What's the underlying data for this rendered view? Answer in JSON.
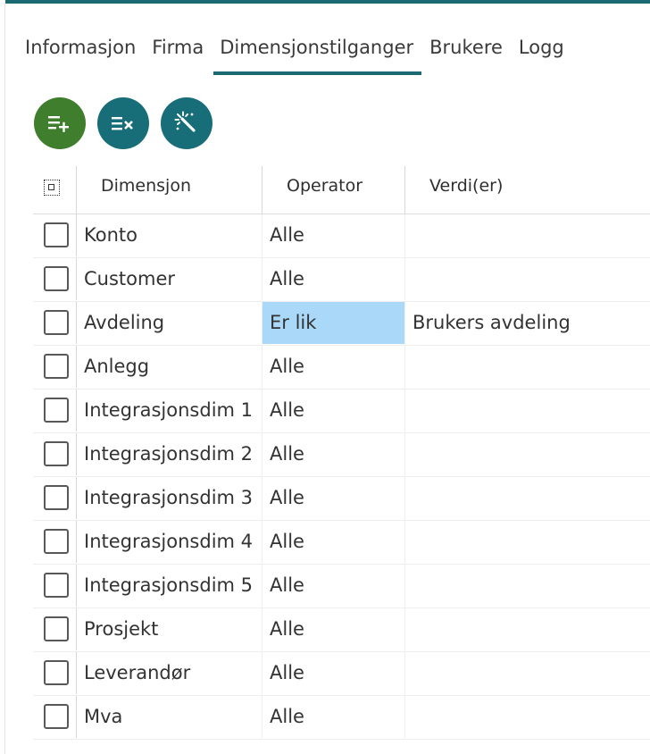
{
  "tabs": [
    {
      "label": "Informasjon",
      "active": false
    },
    {
      "label": "Firma",
      "active": false
    },
    {
      "label": "Dimensjonstilganger",
      "active": true
    },
    {
      "label": "Brukere",
      "active": false
    },
    {
      "label": "Logg",
      "active": false
    }
  ],
  "toolbar": {
    "add_icon": "add-row-icon",
    "remove_icon": "remove-rows-icon",
    "magic_icon": "magic-wand-icon",
    "colors": {
      "add": "#3f7e2c",
      "teal": "#186e78",
      "highlight": "#a9d8f8"
    }
  },
  "grid": {
    "select_all_icon": "select-all-icon",
    "columns": [
      "Dimensjon",
      "Operator",
      "Verdi(er)"
    ],
    "rows": [
      {
        "dimension": "Konto",
        "operator": "Alle",
        "value": "",
        "selected": false
      },
      {
        "dimension": "Customer",
        "operator": "Alle",
        "value": "",
        "selected": false
      },
      {
        "dimension": "Avdeling",
        "operator": "Er lik",
        "value": "Brukers avdeling",
        "selected": false,
        "highlight": true
      },
      {
        "dimension": "Anlegg",
        "operator": "Alle",
        "value": "",
        "selected": false
      },
      {
        "dimension": "Integrasjonsdim 1",
        "operator": "Alle",
        "value": "",
        "selected": false
      },
      {
        "dimension": "Integrasjonsdim 2",
        "operator": "Alle",
        "value": "",
        "selected": false
      },
      {
        "dimension": "Integrasjonsdim 3",
        "operator": "Alle",
        "value": "",
        "selected": false
      },
      {
        "dimension": "Integrasjonsdim 4",
        "operator": "Alle",
        "value": "",
        "selected": false
      },
      {
        "dimension": "Integrasjonsdim 5",
        "operator": "Alle",
        "value": "",
        "selected": false
      },
      {
        "dimension": "Prosjekt",
        "operator": "Alle",
        "value": "",
        "selected": false
      },
      {
        "dimension": "Leverandør",
        "operator": "Alle",
        "value": "",
        "selected": false
      },
      {
        "dimension": "Mva",
        "operator": "Alle",
        "value": "",
        "selected": false
      }
    ]
  }
}
